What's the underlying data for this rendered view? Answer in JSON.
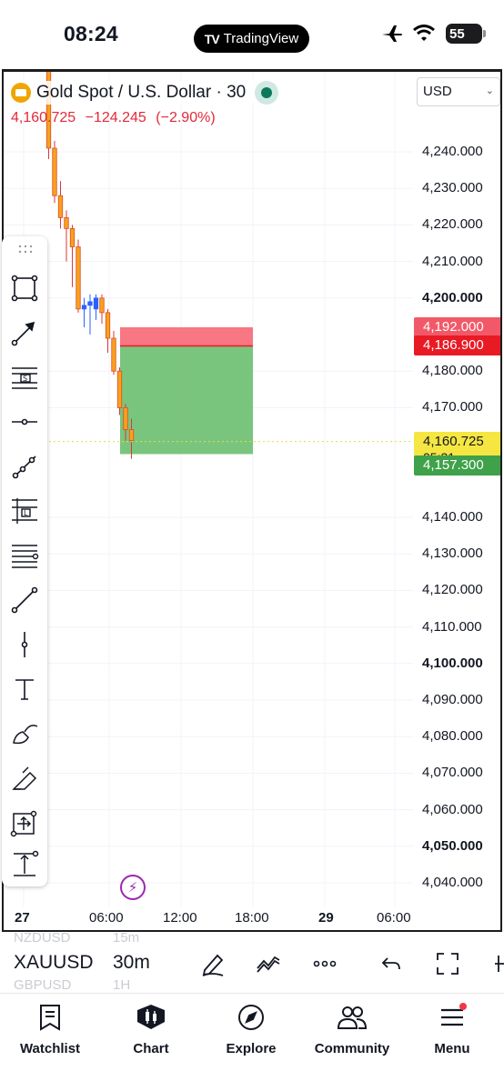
{
  "status_bar": {
    "time": "08:24",
    "app_pill": "TradingView",
    "battery": "55"
  },
  "chart": {
    "title": "Gold Spot / U.S. Dollar · 30",
    "last_price": "4,160.725",
    "change": "−124.245",
    "change_pct": "(−2.90%)",
    "currency": "USD",
    "price_ticks": [
      "4,240.000",
      "4,230.000",
      "4,220.000",
      "4,210.000",
      "4,200.000",
      "4,180.000",
      "4,170.000",
      "4,140.000",
      "4,130.000",
      "4,120.000",
      "4,110.000",
      "4,100.000",
      "4,090.000",
      "4,080.000",
      "4,070.000",
      "4,060.000",
      "4,050.000",
      "4,040.000"
    ],
    "badges": {
      "stop_high": "4,192.000",
      "stop_low": "4,186.900",
      "current": "4,160.725",
      "countdown": "05:31",
      "target": "4,157.300"
    },
    "time_labels": [
      "27",
      "06:00",
      "12:00",
      "18:00",
      "29",
      "06:00"
    ],
    "colors": {
      "up": "#2962ff",
      "down": "#f7a21b",
      "stop_zone": "#f45b69",
      "target_zone": "#5cb85c",
      "current": "#f5e642"
    }
  },
  "chart_data": {
    "type": "candlestick",
    "interval": "30m",
    "symbol": "XAUUSD",
    "ylim": [
      4035,
      4285
    ],
    "yticks": [
      4240,
      4230,
      4220,
      4210,
      4200,
      4180,
      4170,
      4140,
      4130,
      4120,
      4110,
      4100,
      4090,
      4080,
      4070,
      4060,
      4050,
      4040
    ],
    "xticks": [
      "27",
      "06:00",
      "12:00",
      "18:00",
      "29",
      "06:00"
    ],
    "candles": [
      {
        "o": 4283,
        "h": 4287,
        "l": 4280,
        "c": 4284
      },
      {
        "o": 4284,
        "h": 4287,
        "l": 4279,
        "c": 4281
      },
      {
        "o": 4281,
        "h": 4283,
        "l": 4273,
        "c": 4275
      },
      {
        "o": 4275,
        "h": 4277,
        "l": 4238,
        "c": 4241
      },
      {
        "o": 4241,
        "h": 4243,
        "l": 4226,
        "c": 4228
      },
      {
        "o": 4228,
        "h": 4232,
        "l": 4219,
        "c": 4222
      },
      {
        "o": 4222,
        "h": 4224,
        "l": 4210,
        "c": 4219
      },
      {
        "o": 4219,
        "h": 4220,
        "l": 4203,
        "c": 4214
      },
      {
        "o": 4214,
        "h": 4216,
        "l": 4196,
        "c": 4197
      },
      {
        "o": 4197,
        "h": 4200,
        "l": 4192,
        "c": 4198
      },
      {
        "o": 4198,
        "h": 4201,
        "l": 4190,
        "c": 4199
      },
      {
        "o": 4197,
        "h": 4201,
        "l": 4194,
        "c": 4200
      },
      {
        "o": 4200,
        "h": 4201,
        "l": 4193,
        "c": 4196
      },
      {
        "o": 4196,
        "h": 4197,
        "l": 4185,
        "c": 4189
      },
      {
        "o": 4189,
        "h": 4191,
        "l": 4179,
        "c": 4180
      },
      {
        "o": 4180,
        "h": 4181,
        "l": 4168,
        "c": 4170
      },
      {
        "o": 4170,
        "h": 4171,
        "l": 4161,
        "c": 4164
      },
      {
        "o": 4164,
        "h": 4167,
        "l": 4156,
        "c": 4161
      }
    ],
    "position": {
      "stop_high": 4192.0,
      "entry": 4186.9,
      "target": 4157.3
    },
    "last_price": 4160.725
  },
  "symbol_bar": {
    "ghost_above": [
      "NZDUSD",
      "15m"
    ],
    "symbol": "XAUUSD",
    "interval": "30m",
    "ghost_below": [
      "GBPUSD",
      "1H"
    ]
  },
  "nav": {
    "items": [
      {
        "label": "Watchlist",
        "icon": "bookmark-icon"
      },
      {
        "label": "Chart",
        "icon": "candles-icon"
      },
      {
        "label": "Explore",
        "icon": "compass-icon"
      },
      {
        "label": "Community",
        "icon": "people-icon"
      },
      {
        "label": "Menu",
        "icon": "menu-icon"
      }
    ]
  }
}
